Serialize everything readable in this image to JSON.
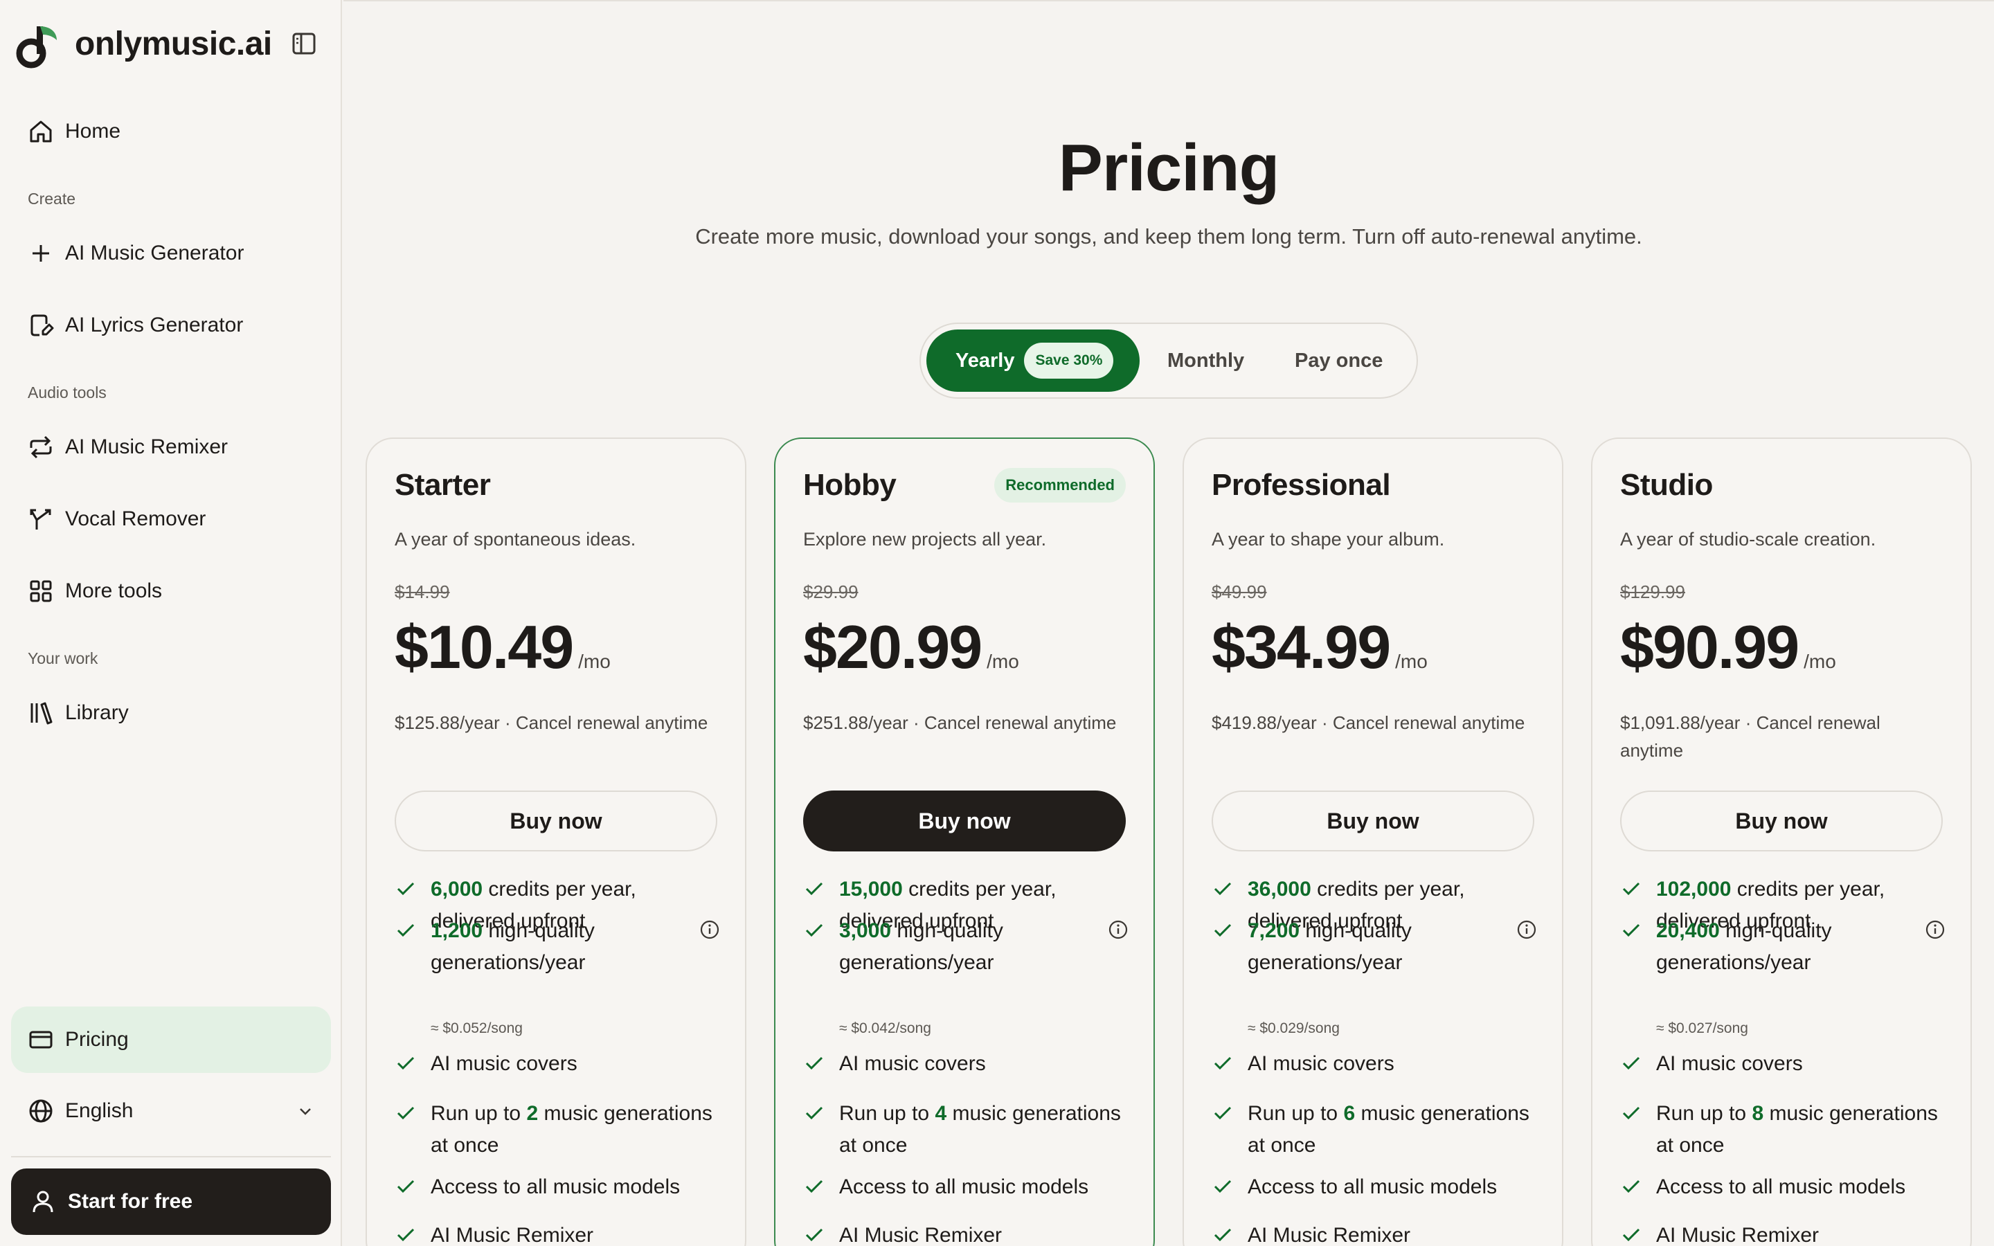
{
  "brand": {
    "name": "onlymusic.ai",
    "accent": "#0f6b2a",
    "logo_icon": "music-note-icon"
  },
  "sidebar": {
    "home": {
      "label": "Home",
      "icon": "home-icon"
    },
    "sections": {
      "create": "Create",
      "audio_tools": "Audio tools",
      "your_work": "Your work"
    },
    "items": [
      {
        "label": "AI Music Generator",
        "icon": "plus-icon"
      },
      {
        "label": "AI Lyrics Generator",
        "icon": "edit-document-icon"
      },
      {
        "label": "AI Music Remixer",
        "icon": "repeat-icon"
      },
      {
        "label": "Vocal Remover",
        "icon": "split-icon"
      },
      {
        "label": "More tools",
        "icon": "grid-icon"
      },
      {
        "label": "Library",
        "icon": "library-icon"
      }
    ],
    "pricing": {
      "label": "Pricing",
      "icon": "credit-card-icon"
    },
    "language": {
      "label": "English",
      "icon": "globe-icon"
    },
    "cta": {
      "label": "Start for free",
      "icon": "user-icon"
    }
  },
  "header": {
    "title": "Pricing",
    "subtitle": "Create more music, download your songs, and keep them long term. Turn off auto-renewal anytime."
  },
  "billing_toggle": {
    "options": [
      "Yearly",
      "Monthly",
      "Pay once"
    ],
    "selected": "Yearly",
    "save_badge": "Save 30%"
  },
  "plans": [
    {
      "name": "Starter",
      "description": "A year of spontaneous ideas.",
      "old_price": "$14.99",
      "price": "$10.49",
      "per": "/mo",
      "billing": "$125.88/year · Cancel renewal anytime",
      "button": "Buy now",
      "credits": "6,000",
      "credits_suffix": " credits per year, delivered upfront",
      "generations": "1,200",
      "generations_suffix": " high-quality generations/year",
      "per_song": "≈ $0.052/song",
      "covers": "AI music covers",
      "run_prefix": "Run up to ",
      "run_count": "2",
      "run_suffix": " music generations at once",
      "models": "Access to all music models",
      "remixer": "AI Music Remixer"
    },
    {
      "name": "Hobby",
      "badge": "Recommended",
      "description": "Explore new projects all year.",
      "old_price": "$29.99",
      "price": "$20.99",
      "per": "/mo",
      "billing": "$251.88/year · Cancel renewal anytime",
      "button": "Buy now",
      "credits": "15,000",
      "credits_suffix": " credits per year, delivered upfront",
      "generations": "3,000",
      "generations_suffix": " high-quality generations/year",
      "per_song": "≈ $0.042/song",
      "covers": "AI music covers",
      "run_prefix": "Run up to ",
      "run_count": "4",
      "run_suffix": " music generations at once",
      "models": "Access to all music models",
      "remixer": "AI Music Remixer"
    },
    {
      "name": "Professional",
      "description": "A year to shape your album.",
      "old_price": "$49.99",
      "price": "$34.99",
      "per": "/mo",
      "billing": "$419.88/year · Cancel renewal anytime",
      "button": "Buy now",
      "credits": "36,000",
      "credits_suffix": " credits per year, delivered upfront",
      "generations": "7,200",
      "generations_suffix": " high-quality generations/year",
      "per_song": "≈ $0.029/song",
      "covers": "AI music covers",
      "run_prefix": "Run up to ",
      "run_count": "6",
      "run_suffix": " music generations at once",
      "models": "Access to all music models",
      "remixer": "AI Music Remixer"
    },
    {
      "name": "Studio",
      "description": "A year of studio-scale creation.",
      "old_price": "$129.99",
      "price": "$90.99",
      "per": "/mo",
      "billing": "$1,091.88/year · Cancel renewal anytime",
      "button": "Buy now",
      "credits": "102,000",
      "credits_suffix": " credits per year, delivered upfront",
      "generations": "20,400",
      "generations_suffix": " high-quality generations/year",
      "per_song": "≈ $0.027/song",
      "covers": "AI music covers",
      "run_prefix": "Run up to ",
      "run_count": "8",
      "run_suffix": " music generations at once",
      "models": "Access to all music models",
      "remixer": "AI Music Remixer"
    }
  ]
}
